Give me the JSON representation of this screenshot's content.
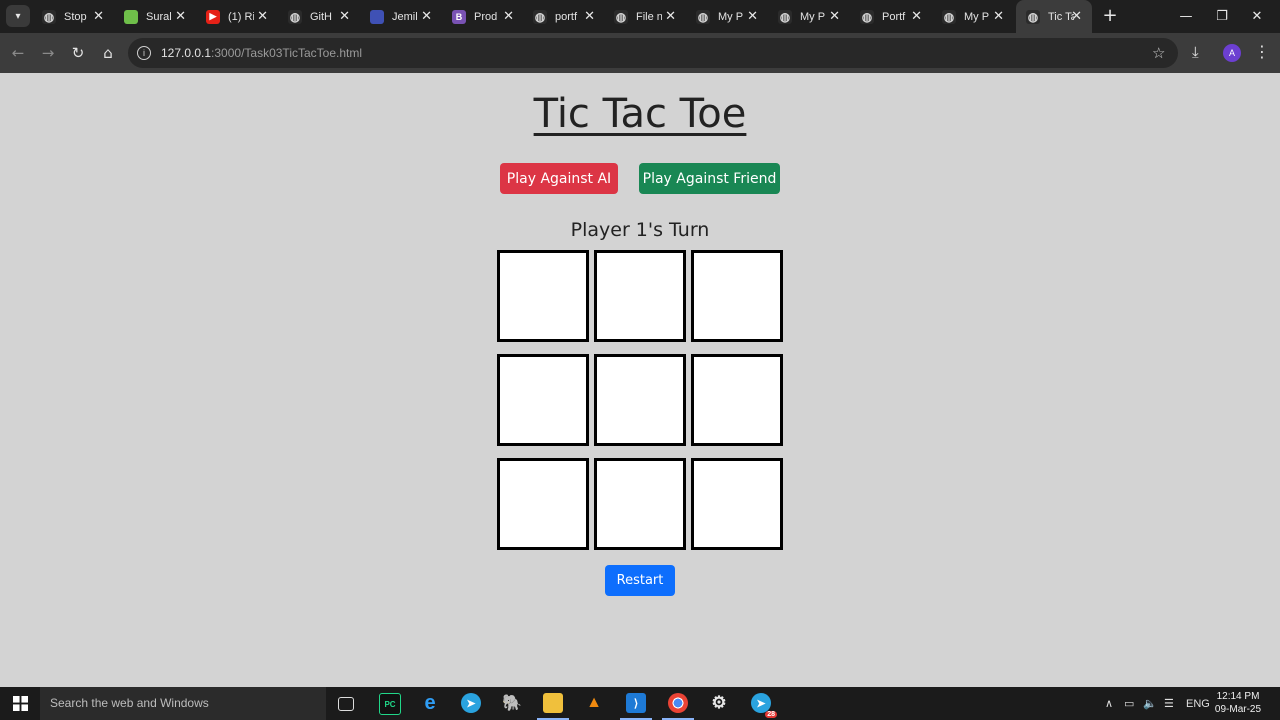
{
  "browser": {
    "tabs": [
      {
        "title": "Stop",
        "favicon": "globe-icon",
        "color": "#2b2b2b"
      },
      {
        "title": "Sural",
        "favicon": "android-icon",
        "color": "#6fbf4a"
      },
      {
        "title": "(1) Ri",
        "favicon": "youtube-icon",
        "color": "#e62117"
      },
      {
        "title": "GitH",
        "favicon": "github-icon",
        "color": "#2b2b2b"
      },
      {
        "title": "Jemil",
        "favicon": "app-icon",
        "color": "#3f51b5"
      },
      {
        "title": "Prod",
        "favicon": "bootstrap-icon",
        "color": "#7952b3"
      },
      {
        "title": "portf",
        "favicon": "github-icon",
        "color": "#2b2b2b"
      },
      {
        "title": "File n",
        "favicon": "globe-icon",
        "color": "#2b2b2b"
      },
      {
        "title": "My P",
        "favicon": "globe-icon",
        "color": "#2b2b2b"
      },
      {
        "title": "My P",
        "favicon": "globe-icon",
        "color": "#2b2b2b"
      },
      {
        "title": "Portf",
        "favicon": "globe-icon",
        "color": "#2b2b2b"
      },
      {
        "title": "My P",
        "favicon": "globe-icon",
        "color": "#2b2b2b"
      },
      {
        "title": "Tic Ta",
        "favicon": "globe-icon",
        "color": "#2b2b2b",
        "active": true
      }
    ],
    "url_host": "127.0.0.1",
    "url_rest": ":3000/Task03TicTacToe.html",
    "profile_initial": "A"
  },
  "page": {
    "title": "Tic Tac Toe",
    "btn_ai": "Play Against AI",
    "btn_friend": "Play Against Friend",
    "status": "Player 1's Turn",
    "board": [
      "",
      "",
      "",
      "",
      "",
      "",
      "",
      "",
      ""
    ],
    "restart": "Restart",
    "colors": {
      "ai": "#dc3545",
      "friend": "#198754",
      "restart": "#0d6efd",
      "background": "#d3d3d3"
    }
  },
  "taskbar": {
    "search_placeholder": "Search the web and Windows",
    "apps": [
      "task-view-icon",
      "pycharm-icon",
      "edge-icon",
      "telegram-icon",
      "postgres-icon",
      "file-explorer-icon",
      "vlc-icon",
      "vscode-icon",
      "chrome-icon",
      "settings-icon",
      "telegram-icon"
    ],
    "language": "ENG",
    "time": "12:14 PM",
    "date": "09-Mar-25",
    "telegram_badge": "28"
  }
}
